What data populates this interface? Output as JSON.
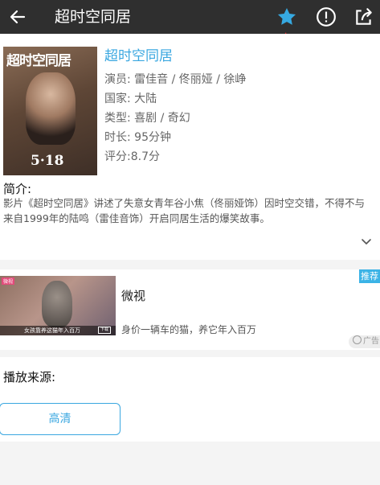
{
  "header": {
    "title": "超时空同居",
    "icons": [
      "back-icon",
      "star-icon",
      "alert-icon",
      "share-icon"
    ],
    "star_color": "#36a9e1"
  },
  "movie": {
    "title": "超时空同居",
    "poster_title": "超时空同居",
    "poster_date": "5·18",
    "cast_line": "演员: 雷佳音 / 佟丽娅 / 徐峥",
    "country_line": "国家: 大陆",
    "genre_line": "类型: 喜剧 / 奇幻",
    "duration_line": "时长: 95分钟",
    "rating_line": "评分:8.7分",
    "intro_heading": "简介:",
    "intro_text": "影片《超时空同居》讲述了失意女青年谷小焦（佟丽娅饰）因时空交错，不得不与来自1999年的陆鸣（雷佳音饰）开启同居生活的爆笑故事。"
  },
  "ad": {
    "recommend_badge": "推荐",
    "app_name": "微视",
    "description": "身价一辆车的猫，养它年入百万",
    "thumb_tag": "微视",
    "thumb_caption": "女孩靠养这猫年入百万",
    "thumb_button": "下载",
    "label": "广告"
  },
  "source": {
    "heading": "播放来源:",
    "options": [
      "高清"
    ]
  },
  "colors": {
    "accent": "#3aa7e0",
    "topbar": "#2f2f2f"
  }
}
